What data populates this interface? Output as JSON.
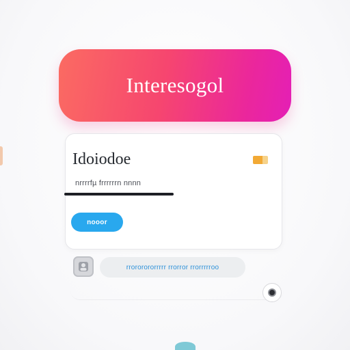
{
  "banner": {
    "title": "Interesogol"
  },
  "card": {
    "title": "Idoiodoe",
    "caption": "nrrrrfµ frrrrrrn  nnnn",
    "button_label": "nooor"
  },
  "chat": {
    "message": "rrororororrrrr rrorror  rrorrrrroo"
  },
  "icons": {
    "card_badge": "badge-icon",
    "avatar": "avatar-icon",
    "record": "record-icon"
  },
  "colors": {
    "banner_gradient_start": "#fb6b62",
    "banner_gradient_end": "#e41fb6",
    "button_blue": "#29a8ee",
    "chat_text_blue": "#2a8fd8",
    "badge_orange": "#f2a935"
  }
}
